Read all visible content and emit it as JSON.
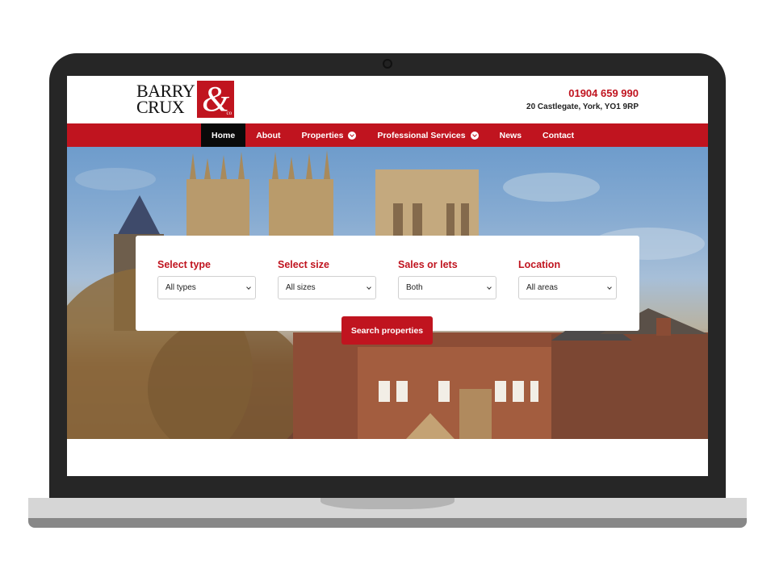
{
  "logo": {
    "line1": "BARRY",
    "line2": "CRUX",
    "ampersand": "&",
    "suffix": "co"
  },
  "header": {
    "phone": "01904 659 990",
    "address": "20 Castlegate, York, YO1 9RP"
  },
  "nav": {
    "items": [
      {
        "label": "Home",
        "active": true,
        "dropdown": false
      },
      {
        "label": "About",
        "dropdown": false
      },
      {
        "label": "Properties",
        "dropdown": true
      },
      {
        "label": "Professional Services",
        "dropdown": true
      },
      {
        "label": "News",
        "dropdown": false
      },
      {
        "label": "Contact",
        "dropdown": false
      }
    ]
  },
  "search": {
    "fields": [
      {
        "label": "Select type",
        "value": "All types"
      },
      {
        "label": "Select size",
        "value": "All sizes"
      },
      {
        "label": "Sales or lets",
        "value": "Both"
      },
      {
        "label": "Location",
        "value": "All areas"
      }
    ],
    "button_label": "Search properties"
  },
  "colors": {
    "brand_red": "#c0141f",
    "nav_active": "#0a0a0a",
    "laptop_bezel": "#262626"
  }
}
